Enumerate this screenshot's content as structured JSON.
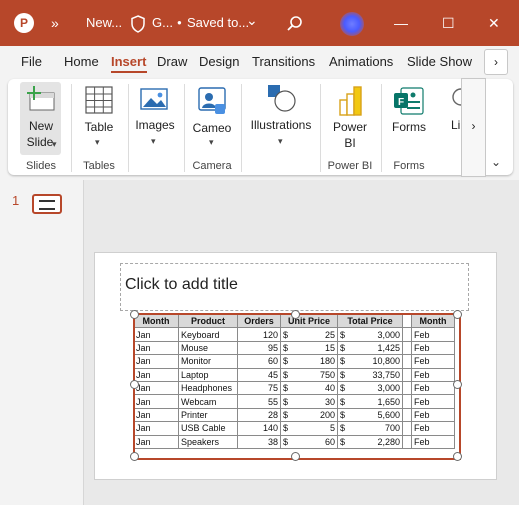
{
  "titlebar": {
    "app_icon": "P",
    "more_commands": "»",
    "doc_name": "New...",
    "shield_label": "G...",
    "save_status": "Saved to...",
    "chevron": "⌄",
    "search_icon": "search-icon",
    "controls": [
      "—",
      "☐",
      "✕"
    ],
    "background": "#b7472a"
  },
  "tabs": {
    "items": [
      "File",
      "Home",
      "Insert",
      "Draw",
      "Design",
      "Transitions",
      "Animations",
      "Slide Show"
    ],
    "active": "Insert",
    "more": "›"
  },
  "ribbon": {
    "new_slide": {
      "label_1": "New",
      "label_2": "Slide"
    },
    "table": {
      "label": "Table"
    },
    "images": {
      "label": "Images"
    },
    "cameo": {
      "label": "Cameo"
    },
    "illustrations": {
      "label": "Illustrations"
    },
    "power_bi": {
      "label_1": "Power",
      "label_2": "BI"
    },
    "forms": {
      "label": "Forms"
    },
    "links": {
      "label": "Li"
    },
    "groups": [
      "Slides",
      "Tables",
      "Camera",
      "Power BI",
      "Forms"
    ],
    "scroll_right": "›",
    "collapse": "⌄"
  },
  "slides_pane": {
    "slide_number": "1"
  },
  "slide": {
    "title_placeholder": "Click to add title",
    "table": {
      "headers": [
        "Month",
        "Product",
        "Orders",
        "Unit Price",
        "Total Price",
        "Month"
      ],
      "rows": [
        {
          "month": "Jan",
          "product": "Keyboard",
          "orders": "120",
          "unit_cur": "$",
          "unit": "25",
          "total_cur": "$",
          "total": "3,000",
          "month2": "Feb"
        },
        {
          "month": "Jan",
          "product": "Mouse",
          "orders": "95",
          "unit_cur": "$",
          "unit": "15",
          "total_cur": "$",
          "total": "1,425",
          "month2": "Feb"
        },
        {
          "month": "Jan",
          "product": "Monitor",
          "orders": "60",
          "unit_cur": "$",
          "unit": "180",
          "total_cur": "$",
          "total": "10,800",
          "month2": "Feb"
        },
        {
          "month": "Jan",
          "product": "Laptop",
          "orders": "45",
          "unit_cur": "$",
          "unit": "750",
          "total_cur": "$",
          "total": "33,750",
          "month2": "Feb"
        },
        {
          "month": "Jan",
          "product": "Headphones",
          "orders": "75",
          "unit_cur": "$",
          "unit": "40",
          "total_cur": "$",
          "total": "3,000",
          "month2": "Feb"
        },
        {
          "month": "Jan",
          "product": "Webcam",
          "orders": "55",
          "unit_cur": "$",
          "unit": "30",
          "total_cur": "$",
          "total": "1,650",
          "month2": "Feb"
        },
        {
          "month": "Jan",
          "product": "Printer",
          "orders": "28",
          "unit_cur": "$",
          "unit": "200",
          "total_cur": "$",
          "total": "5,600",
          "month2": "Feb"
        },
        {
          "month": "Jan",
          "product": "USB Cable",
          "orders": "140",
          "unit_cur": "$",
          "unit": "5",
          "total_cur": "$",
          "total": "700",
          "month2": "Feb"
        },
        {
          "month": "Jan",
          "product": "Speakers",
          "orders": "38",
          "unit_cur": "$",
          "unit": "60",
          "total_cur": "$",
          "total": "2,280",
          "month2": "Feb"
        }
      ]
    }
  },
  "colors": {
    "accent": "#b7472a",
    "header_fill": "#d9d9d9"
  }
}
